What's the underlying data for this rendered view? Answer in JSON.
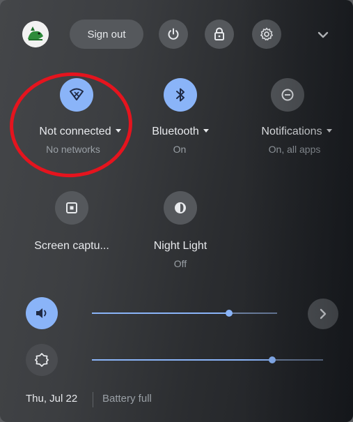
{
  "header": {
    "sign_out_label": "Sign out",
    "icons": [
      "power-icon",
      "lock-icon",
      "gear-icon",
      "chevron-down-icon"
    ]
  },
  "tiles": [
    {
      "label": "Not connected",
      "sub": "No networks",
      "icon": "wifi-icon",
      "state": "on",
      "has_menu": true
    },
    {
      "label": "Bluetooth",
      "sub": "On",
      "icon": "bluetooth-icon",
      "state": "on",
      "has_menu": true
    },
    {
      "label": "Notifications",
      "sub": "On, all apps",
      "icon": "notifications-icon",
      "state": "off",
      "has_menu": true
    },
    {
      "label": "Screen captu...",
      "sub": "",
      "icon": "screen-capture-icon",
      "state": "off",
      "has_menu": false
    },
    {
      "label": "Night Light",
      "sub": "Off",
      "icon": "night-light-icon",
      "state": "off",
      "has_menu": false
    }
  ],
  "sliders": {
    "volume": {
      "level": 0.74,
      "icon": "volume-icon"
    },
    "brightness": {
      "level": 0.78,
      "icon": "brightness-icon"
    }
  },
  "footer": {
    "date": "Thu, Jul 22",
    "battery": "Battery full"
  },
  "colors": {
    "accent": "#8ab4f8",
    "annotation": "#e5141e"
  }
}
